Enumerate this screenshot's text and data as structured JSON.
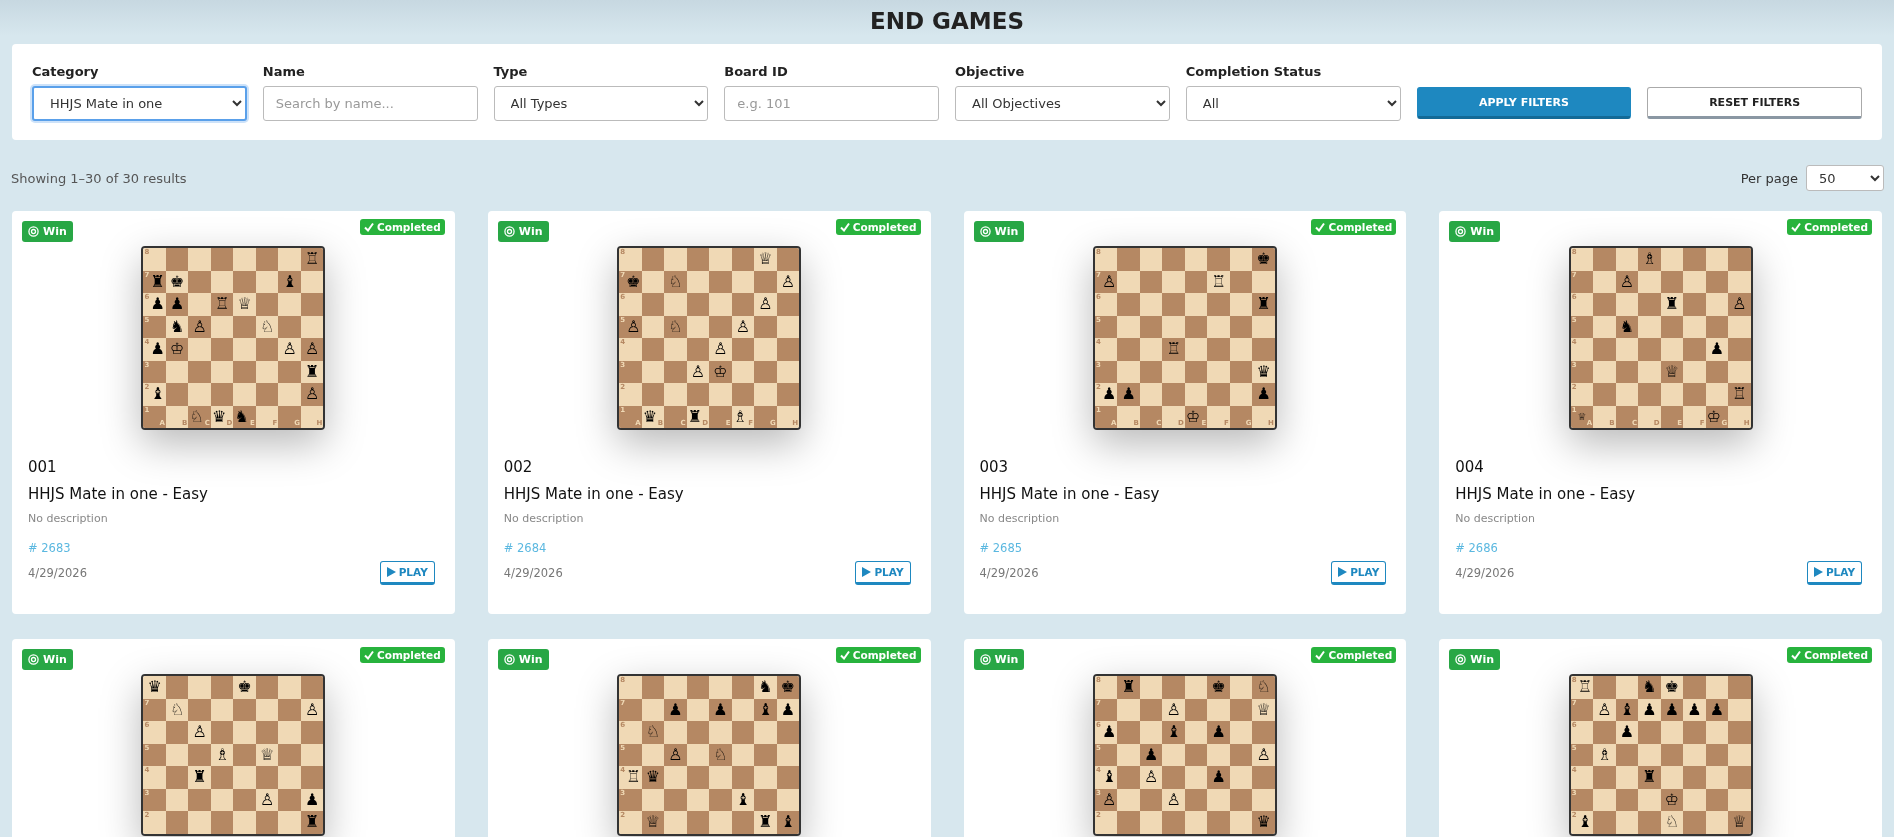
{
  "page_title": "END GAMES",
  "filters": [
    {
      "kind": "select",
      "label": "Category",
      "value": "HHJS Mate in one",
      "focused": true
    },
    {
      "kind": "text",
      "label": "Name",
      "placeholder": "Search by name...",
      "focused": false
    },
    {
      "kind": "select",
      "label": "Type",
      "value": "All Types",
      "focused": false
    },
    {
      "kind": "text",
      "label": "Board ID",
      "placeholder": "e.g. 101",
      "focused": false
    },
    {
      "kind": "select",
      "label": "Objective",
      "value": "All Objectives",
      "focused": false
    },
    {
      "kind": "select",
      "label": "Completion Status",
      "value": "All",
      "focused": false
    }
  ],
  "buttons": [
    {
      "label": "APPLY FILTERS",
      "kind": "primary"
    },
    {
      "label": "RESET FILTERS",
      "kind": "secondary"
    }
  ],
  "results_summary": "Showing 1–30 of 30 results",
  "per_page": {
    "label": "Per page",
    "value": "50"
  },
  "cards": [
    {
      "objective": "Win",
      "status": "Completed",
      "board": {
        "rank_labels": [
          "8",
          "7",
          "6",
          "5",
          "4",
          "3",
          "2",
          "1"
        ],
        "file_labels": [
          "A",
          "B",
          "C",
          "D",
          "E",
          "F",
          "G",
          "H"
        ],
        "ranks": [
          [
            {
              "kind": "light"
            },
            {
              "kind": "dark"
            },
            {
              "kind": "light"
            },
            {
              "kind": "dark"
            },
            {
              "kind": "light"
            },
            {
              "kind": "dark"
            },
            {
              "kind": "light"
            },
            {
              "kind": "dark",
              "piece": "♖"
            }
          ],
          [
            {
              "kind": "dark",
              "piece": "♜"
            },
            {
              "kind": "light",
              "piece": "♚"
            },
            {
              "kind": "dark"
            },
            {
              "kind": "light"
            },
            {
              "kind": "dark"
            },
            {
              "kind": "light"
            },
            {
              "kind": "dark",
              "piece": "♝"
            },
            {
              "kind": "light"
            }
          ],
          [
            {
              "kind": "light",
              "piece": "♟"
            },
            {
              "kind": "dark",
              "piece": "♟"
            },
            {
              "kind": "light"
            },
            {
              "kind": "dark",
              "piece": "♖"
            },
            {
              "kind": "light",
              "piece": "♕"
            },
            {
              "kind": "dark"
            },
            {
              "kind": "light"
            },
            {
              "kind": "dark"
            }
          ],
          [
            {
              "kind": "dark"
            },
            {
              "kind": "light",
              "piece": "♞"
            },
            {
              "kind": "dark",
              "piece": "♙"
            },
            {
              "kind": "light"
            },
            {
              "kind": "dark"
            },
            {
              "kind": "light",
              "piece": "♘"
            },
            {
              "kind": "dark"
            },
            {
              "kind": "light"
            }
          ],
          [
            {
              "kind": "light",
              "piece": "♟"
            },
            {
              "kind": "dark",
              "piece": "♔"
            },
            {
              "kind": "light"
            },
            {
              "kind": "dark"
            },
            {
              "kind": "light"
            },
            {
              "kind": "dark"
            },
            {
              "kind": "light",
              "piece": "♙"
            },
            {
              "kind": "dark",
              "piece": "♙"
            }
          ],
          [
            {
              "kind": "dark"
            },
            {
              "kind": "light"
            },
            {
              "kind": "dark"
            },
            {
              "kind": "light"
            },
            {
              "kind": "dark"
            },
            {
              "kind": "light"
            },
            {
              "kind": "dark"
            },
            {
              "kind": "light",
              "piece": "♜"
            }
          ],
          [
            {
              "kind": "light",
              "piece": "♝"
            },
            {
              "kind": "dark"
            },
            {
              "kind": "light"
            },
            {
              "kind": "dark"
            },
            {
              "kind": "light"
            },
            {
              "kind": "dark"
            },
            {
              "kind": "light"
            },
            {
              "kind": "dark",
              "piece": "♙"
            }
          ],
          [
            {
              "kind": "dark"
            },
            {
              "kind": "light"
            },
            {
              "kind": "dark",
              "piece": "♘"
            },
            {
              "kind": "light",
              "piece": "♛"
            },
            {
              "kind": "dark",
              "piece": "♞"
            },
            {
              "kind": "light"
            },
            {
              "kind": "dark"
            },
            {
              "kind": "light"
            }
          ]
        ]
      },
      "number": "001",
      "title": "HHJS Mate in one - Easy",
      "description": "No description",
      "id": "# 2683",
      "date": "4/29/2026",
      "action": "PLAY"
    },
    {
      "objective": "Win",
      "status": "Completed",
      "board": {
        "rank_labels": [
          "8",
          "7",
          "6",
          "5",
          "4",
          "3",
          "2",
          "1"
        ],
        "file_labels": [
          "A",
          "B",
          "C",
          "D",
          "E",
          "F",
          "G",
          "H"
        ],
        "ranks": [
          [
            {
              "kind": "light"
            },
            {
              "kind": "dark"
            },
            {
              "kind": "light"
            },
            {
              "kind": "dark"
            },
            {
              "kind": "light"
            },
            {
              "kind": "dark"
            },
            {
              "kind": "light",
              "piece": "♕"
            },
            {
              "kind": "dark"
            }
          ],
          [
            {
              "kind": "dark",
              "piece": "♚"
            },
            {
              "kind": "light"
            },
            {
              "kind": "dark",
              "piece": "♘"
            },
            {
              "kind": "light"
            },
            {
              "kind": "dark"
            },
            {
              "kind": "light"
            },
            {
              "kind": "dark"
            },
            {
              "kind": "light",
              "piece": "♙"
            }
          ],
          [
            {
              "kind": "light"
            },
            {
              "kind": "dark"
            },
            {
              "kind": "light"
            },
            {
              "kind": "dark"
            },
            {
              "kind": "light"
            },
            {
              "kind": "dark"
            },
            {
              "kind": "light",
              "piece": "♙"
            },
            {
              "kind": "dark"
            }
          ],
          [
            {
              "kind": "dark",
              "piece": "♙"
            },
            {
              "kind": "light"
            },
            {
              "kind": "dark",
              "piece": "♘"
            },
            {
              "kind": "light"
            },
            {
              "kind": "dark"
            },
            {
              "kind": "light",
              "piece": "♙"
            },
            {
              "kind": "dark"
            },
            {
              "kind": "light"
            }
          ],
          [
            {
              "kind": "light"
            },
            {
              "kind": "dark"
            },
            {
              "kind": "light"
            },
            {
              "kind": "dark"
            },
            {
              "kind": "light",
              "piece": "♙"
            },
            {
              "kind": "dark"
            },
            {
              "kind": "light"
            },
            {
              "kind": "dark"
            }
          ],
          [
            {
              "kind": "dark"
            },
            {
              "kind": "light"
            },
            {
              "kind": "dark"
            },
            {
              "kind": "light",
              "piece": "♙"
            },
            {
              "kind": "dark",
              "piece": "♔"
            },
            {
              "kind": "light"
            },
            {
              "kind": "dark"
            },
            {
              "kind": "light"
            }
          ],
          [
            {
              "kind": "light"
            },
            {
              "kind": "dark"
            },
            {
              "kind": "light"
            },
            {
              "kind": "dark"
            },
            {
              "kind": "light"
            },
            {
              "kind": "dark"
            },
            {
              "kind": "light"
            },
            {
              "kind": "dark"
            }
          ],
          [
            {
              "kind": "dark"
            },
            {
              "kind": "light",
              "piece": "♛"
            },
            {
              "kind": "dark"
            },
            {
              "kind": "light",
              "piece": "♜"
            },
            {
              "kind": "dark"
            },
            {
              "kind": "light",
              "piece": "♗"
            },
            {
              "kind": "dark"
            },
            {
              "kind": "light"
            }
          ]
        ]
      },
      "number": "002",
      "title": "HHJS Mate in one - Easy",
      "description": "No description",
      "id": "# 2684",
      "date": "4/29/2026",
      "action": "PLAY"
    },
    {
      "objective": "Win",
      "status": "Completed",
      "board": {
        "rank_labels": [
          "8",
          "7",
          "6",
          "5",
          "4",
          "3",
          "2",
          "1"
        ],
        "file_labels": [
          "A",
          "B",
          "C",
          "D",
          "E",
          "F",
          "G",
          "H"
        ],
        "ranks": [
          [
            {
              "kind": "light"
            },
            {
              "kind": "dark"
            },
            {
              "kind": "light"
            },
            {
              "kind": "dark"
            },
            {
              "kind": "light"
            },
            {
              "kind": "dark"
            },
            {
              "kind": "light"
            },
            {
              "kind": "dark",
              "piece": "♚"
            }
          ],
          [
            {
              "kind": "dark",
              "piece": "♙"
            },
            {
              "kind": "light"
            },
            {
              "kind": "dark"
            },
            {
              "kind": "light"
            },
            {
              "kind": "dark"
            },
            {
              "kind": "light",
              "piece": "♖"
            },
            {
              "kind": "dark"
            },
            {
              "kind": "light"
            }
          ],
          [
            {
              "kind": "light"
            },
            {
              "kind": "dark"
            },
            {
              "kind": "light"
            },
            {
              "kind": "dark"
            },
            {
              "kind": "light"
            },
            {
              "kind": "dark"
            },
            {
              "kind": "light"
            },
            {
              "kind": "dark",
              "piece": "♜"
            }
          ],
          [
            {
              "kind": "dark"
            },
            {
              "kind": "light"
            },
            {
              "kind": "dark"
            },
            {
              "kind": "light"
            },
            {
              "kind": "dark"
            },
            {
              "kind": "light"
            },
            {
              "kind": "dark"
            },
            {
              "kind": "light"
            }
          ],
          [
            {
              "kind": "light"
            },
            {
              "kind": "dark"
            },
            {
              "kind": "light"
            },
            {
              "kind": "dark",
              "piece": "♖"
            },
            {
              "kind": "light"
            },
            {
              "kind": "dark"
            },
            {
              "kind": "light"
            },
            {
              "kind": "dark"
            }
          ],
          [
            {
              "kind": "dark"
            },
            {
              "kind": "light"
            },
            {
              "kind": "dark"
            },
            {
              "kind": "light"
            },
            {
              "kind": "dark"
            },
            {
              "kind": "light"
            },
            {
              "kind": "dark"
            },
            {
              "kind": "light",
              "piece": "♛"
            }
          ],
          [
            {
              "kind": "light",
              "piece": "♟"
            },
            {
              "kind": "dark",
              "piece": "♟"
            },
            {
              "kind": "light"
            },
            {
              "kind": "dark"
            },
            {
              "kind": "light"
            },
            {
              "kind": "dark"
            },
            {
              "kind": "light"
            },
            {
              "kind": "dark",
              "piece": "♟"
            }
          ],
          [
            {
              "kind": "dark"
            },
            {
              "kind": "light"
            },
            {
              "kind": "dark"
            },
            {
              "kind": "light"
            },
            {
              "kind": "dark",
              "piece": "♔"
            },
            {
              "kind": "light"
            },
            {
              "kind": "dark"
            },
            {
              "kind": "light"
            }
          ]
        ]
      },
      "number": "003",
      "title": "HHJS Mate in one - Easy",
      "description": "No description",
      "id": "# 2685",
      "date": "4/29/2026",
      "action": "PLAY"
    },
    {
      "objective": "Win",
      "status": "Completed",
      "board": {
        "rank_labels": [
          "8",
          "7",
          "6",
          "5",
          "4",
          "3",
          "2",
          "1"
        ],
        "file_labels": [
          "A",
          "B",
          "C",
          "D",
          "E",
          "F",
          "G",
          "H"
        ],
        "ranks": [
          [
            {
              "kind": "light"
            },
            {
              "kind": "dark"
            },
            {
              "kind": "light"
            },
            {
              "kind": "dark",
              "piece": "♗"
            },
            {
              "kind": "light"
            },
            {
              "kind": "dark"
            },
            {
              "kind": "light"
            },
            {
              "kind": "dark"
            }
          ],
          [
            {
              "kind": "dark"
            },
            {
              "kind": "light"
            },
            {
              "kind": "dark",
              "piece": "♙"
            },
            {
              "kind": "light"
            },
            {
              "kind": "dark"
            },
            {
              "kind": "light"
            },
            {
              "kind": "dark"
            },
            {
              "kind": "light"
            }
          ],
          [
            {
              "kind": "light"
            },
            {
              "kind": "dark"
            },
            {
              "kind": "light"
            },
            {
              "kind": "dark"
            },
            {
              "kind": "light",
              "piece": "♜"
            },
            {
              "kind": "dark"
            },
            {
              "kind": "light"
            },
            {
              "kind": "dark",
              "piece": "♙"
            }
          ],
          [
            {
              "kind": "dark"
            },
            {
              "kind": "light"
            },
            {
              "kind": "dark",
              "piece": "♞"
            },
            {
              "kind": "light"
            },
            {
              "kind": "dark"
            },
            {
              "kind": "light"
            },
            {
              "kind": "dark"
            },
            {
              "kind": "light"
            }
          ],
          [
            {
              "kind": "light"
            },
            {
              "kind": "dark"
            },
            {
              "kind": "light"
            },
            {
              "kind": "dark"
            },
            {
              "kind": "light"
            },
            {
              "kind": "dark"
            },
            {
              "kind": "light",
              "piece": "♟"
            },
            {
              "kind": "dark"
            }
          ],
          [
            {
              "kind": "dark"
            },
            {
              "kind": "light"
            },
            {
              "kind": "dark"
            },
            {
              "kind": "light"
            },
            {
              "kind": "dark",
              "piece": "♕"
            },
            {
              "kind": "light"
            },
            {
              "kind": "dark"
            },
            {
              "kind": "light"
            }
          ],
          [
            {
              "kind": "light"
            },
            {
              "kind": "dark"
            },
            {
              "kind": "light"
            },
            {
              "kind": "dark"
            },
            {
              "kind": "light"
            },
            {
              "kind": "dark"
            },
            {
              "kind": "light"
            },
            {
              "kind": "dark",
              "piece": "♖"
            }
          ],
          [
            {
              "kind": "dark",
              "piece": "♕"
            },
            {
              "kind": "light"
            },
            {
              "kind": "dark"
            },
            {
              "kind": "light"
            },
            {
              "kind": "dark"
            },
            {
              "kind": "light"
            },
            {
              "kind": "dark",
              "piece": "♔"
            },
            {
              "kind": "light"
            }
          ]
        ]
      },
      "number": "004",
      "title": "HHJS Mate in one - Easy",
      "description": "No description",
      "id": "# 2686",
      "date": "4/29/2026",
      "action": "PLAY"
    },
    {
      "objective": "Win",
      "status": "Completed",
      "board": {
        "rank_labels": [
          "7",
          "6",
          "5",
          "4",
          "3",
          "2"
        ],
        "ranks": [
          [
            {
              "kind": "light",
              "piece": "♛"
            },
            {
              "kind": "dark"
            },
            {
              "kind": "light"
            },
            {
              "kind": "dark"
            },
            {
              "kind": "light",
              "piece": "♚"
            },
            {
              "kind": "dark"
            },
            {
              "kind": "light"
            },
            {
              "kind": "dark"
            }
          ],
          [
            {
              "kind": "dark"
            },
            {
              "kind": "light",
              "piece": "♘"
            },
            {
              "kind": "dark"
            },
            {
              "kind": "light"
            },
            {
              "kind": "dark"
            },
            {
              "kind": "light"
            },
            {
              "kind": "dark"
            },
            {
              "kind": "light",
              "piece": "♙"
            }
          ],
          [
            {
              "kind": "light"
            },
            {
              "kind": "dark"
            },
            {
              "kind": "light",
              "piece": "♙"
            },
            {
              "kind": "dark"
            },
            {
              "kind": "light"
            },
            {
              "kind": "dark"
            },
            {
              "kind": "light"
            },
            {
              "kind": "dark"
            }
          ],
          [
            {
              "kind": "dark"
            },
            {
              "kind": "light"
            },
            {
              "kind": "dark"
            },
            {
              "kind": "light",
              "piece": "♗"
            },
            {
              "kind": "dark"
            },
            {
              "kind": "light",
              "piece": "♕"
            },
            {
              "kind": "dark"
            },
            {
              "kind": "light"
            }
          ],
          [
            {
              "kind": "light"
            },
            {
              "kind": "dark"
            },
            {
              "kind": "light",
              "piece": "♜"
            },
            {
              "kind": "dark"
            },
            {
              "kind": "light"
            },
            {
              "kind": "dark"
            },
            {
              "kind": "light"
            },
            {
              "kind": "dark"
            }
          ],
          [
            {
              "kind": "dark"
            },
            {
              "kind": "light"
            },
            {
              "kind": "dark"
            },
            {
              "kind": "light"
            },
            {
              "kind": "dark"
            },
            {
              "kind": "light",
              "piece": "♙"
            },
            {
              "kind": "dark"
            },
            {
              "kind": "light",
              "piece": "♟"
            }
          ],
          [
            {
              "kind": "light"
            },
            {
              "kind": "dark"
            },
            {
              "kind": "light"
            },
            {
              "kind": "dark"
            },
            {
              "kind": "light"
            },
            {
              "kind": "dark"
            },
            {
              "kind": "light"
            },
            {
              "kind": "dark",
              "piece": "♜"
            }
          ]
        ]
      }
    },
    {
      "objective": "Win",
      "status": "Completed",
      "board": {
        "rank_labels": [
          "8",
          "7",
          "6",
          "5",
          "4",
          "3",
          "2"
        ],
        "ranks": [
          [
            {
              "kind": "light"
            },
            {
              "kind": "dark"
            },
            {
              "kind": "light"
            },
            {
              "kind": "dark"
            },
            {
              "kind": "light"
            },
            {
              "kind": "dark"
            },
            {
              "kind": "light",
              "piece": "♞"
            },
            {
              "kind": "dark",
              "piece": "♚"
            }
          ],
          [
            {
              "kind": "dark"
            },
            {
              "kind": "light"
            },
            {
              "kind": "dark",
              "piece": "♟"
            },
            {
              "kind": "light"
            },
            {
              "kind": "dark",
              "piece": "♟"
            },
            {
              "kind": "light"
            },
            {
              "kind": "dark",
              "piece": "♝"
            },
            {
              "kind": "light",
              "piece": "♟"
            }
          ],
          [
            {
              "kind": "light"
            },
            {
              "kind": "dark",
              "piece": "♘"
            },
            {
              "kind": "light"
            },
            {
              "kind": "dark"
            },
            {
              "kind": "light"
            },
            {
              "kind": "dark"
            },
            {
              "kind": "light"
            },
            {
              "kind": "dark"
            }
          ],
          [
            {
              "kind": "dark"
            },
            {
              "kind": "light"
            },
            {
              "kind": "dark",
              "piece": "♙"
            },
            {
              "kind": "light"
            },
            {
              "kind": "dark",
              "piece": "♘"
            },
            {
              "kind": "light"
            },
            {
              "kind": "dark"
            },
            {
              "kind": "light"
            }
          ],
          [
            {
              "kind": "light",
              "piece": "♖"
            },
            {
              "kind": "dark",
              "piece": "♛"
            },
            {
              "kind": "light"
            },
            {
              "kind": "dark"
            },
            {
              "kind": "light"
            },
            {
              "kind": "dark"
            },
            {
              "kind": "light"
            },
            {
              "kind": "dark"
            }
          ],
          [
            {
              "kind": "dark"
            },
            {
              "kind": "light"
            },
            {
              "kind": "dark"
            },
            {
              "kind": "light"
            },
            {
              "kind": "dark"
            },
            {
              "kind": "light",
              "piece": "♝"
            },
            {
              "kind": "dark"
            },
            {
              "kind": "light"
            }
          ],
          [
            {
              "kind": "light"
            },
            {
              "kind": "dark",
              "piece": "♕"
            },
            {
              "kind": "light"
            },
            {
              "kind": "dark"
            },
            {
              "kind": "light"
            },
            {
              "kind": "dark"
            },
            {
              "kind": "light",
              "piece": "♜"
            },
            {
              "kind": "dark",
              "piece": "♝"
            }
          ]
        ]
      }
    },
    {
      "objective": "Win",
      "status": "Completed",
      "board": {
        "rank_labels": [
          "8",
          "7",
          "6",
          "5",
          "4",
          "3",
          "2"
        ],
        "ranks": [
          [
            {
              "kind": "light"
            },
            {
              "kind": "dark",
              "piece": "♜"
            },
            {
              "kind": "light"
            },
            {
              "kind": "dark"
            },
            {
              "kind": "light"
            },
            {
              "kind": "dark",
              "piece": "♚"
            },
            {
              "kind": "light"
            },
            {
              "kind": "dark",
              "piece": "♘"
            }
          ],
          [
            {
              "kind": "dark"
            },
            {
              "kind": "light"
            },
            {
              "kind": "dark"
            },
            {
              "kind": "light",
              "piece": "♙"
            },
            {
              "kind": "dark"
            },
            {
              "kind": "light"
            },
            {
              "kind": "dark"
            },
            {
              "kind": "light",
              "piece": "♕"
            }
          ],
          [
            {
              "kind": "light",
              "piece": "♟"
            },
            {
              "kind": "dark"
            },
            {
              "kind": "light"
            },
            {
              "kind": "dark",
              "piece": "♝"
            },
            {
              "kind": "light"
            },
            {
              "kind": "dark",
              "piece": "♟"
            },
            {
              "kind": "light"
            },
            {
              "kind": "dark"
            }
          ],
          [
            {
              "kind": "dark"
            },
            {
              "kind": "light"
            },
            {
              "kind": "dark",
              "piece": "♟"
            },
            {
              "kind": "light"
            },
            {
              "kind": "dark"
            },
            {
              "kind": "light"
            },
            {
              "kind": "dark"
            },
            {
              "kind": "light",
              "piece": "♙"
            }
          ],
          [
            {
              "kind": "light",
              "piece": "♝"
            },
            {
              "kind": "dark"
            },
            {
              "kind": "light",
              "piece": "♙"
            },
            {
              "kind": "dark"
            },
            {
              "kind": "light"
            },
            {
              "kind": "dark",
              "piece": "♟"
            },
            {
              "kind": "light"
            },
            {
              "kind": "dark"
            }
          ],
          [
            {
              "kind": "dark",
              "piece": "♙"
            },
            {
              "kind": "light"
            },
            {
              "kind": "dark"
            },
            {
              "kind": "light",
              "piece": "♙"
            },
            {
              "kind": "dark"
            },
            {
              "kind": "light"
            },
            {
              "kind": "dark"
            },
            {
              "kind": "light"
            }
          ],
          [
            {
              "kind": "light"
            },
            {
              "kind": "dark"
            },
            {
              "kind": "light"
            },
            {
              "kind": "dark"
            },
            {
              "kind": "light"
            },
            {
              "kind": "dark"
            },
            {
              "kind": "light"
            },
            {
              "kind": "dark",
              "piece": "♛"
            }
          ]
        ]
      }
    },
    {
      "objective": "Win",
      "status": "Completed",
      "board": {
        "rank_labels": [
          "8",
          "7",
          "6",
          "5",
          "4",
          "3",
          "2"
        ],
        "ranks": [
          [
            {
              "kind": "light",
              "piece": "♖"
            },
            {
              "kind": "dark"
            },
            {
              "kind": "light"
            },
            {
              "kind": "dark",
              "piece": "♞"
            },
            {
              "kind": "light",
              "piece": "♚"
            },
            {
              "kind": "dark"
            },
            {
              "kind": "light"
            },
            {
              "kind": "dark"
            }
          ],
          [
            {
              "kind": "dark"
            },
            {
              "kind": "light",
              "piece": "♙"
            },
            {
              "kind": "dark",
              "piece": "♝"
            },
            {
              "kind": "light",
              "piece": "♟"
            },
            {
              "kind": "dark",
              "piece": "♟"
            },
            {
              "kind": "light",
              "piece": "♟"
            },
            {
              "kind": "dark",
              "piece": "♟"
            },
            {
              "kind": "light"
            }
          ],
          [
            {
              "kind": "light"
            },
            {
              "kind": "dark"
            },
            {
              "kind": "light",
              "piece": "♟"
            },
            {
              "kind": "dark"
            },
            {
              "kind": "light"
            },
            {
              "kind": "dark"
            },
            {
              "kind": "light"
            },
            {
              "kind": "dark"
            }
          ],
          [
            {
              "kind": "dark"
            },
            {
              "kind": "light",
              "piece": "♗"
            },
            {
              "kind": "dark"
            },
            {
              "kind": "light"
            },
            {
              "kind": "dark"
            },
            {
              "kind": "light"
            },
            {
              "kind": "dark"
            },
            {
              "kind": "light"
            }
          ],
          [
            {
              "kind": "light"
            },
            {
              "kind": "dark"
            },
            {
              "kind": "light"
            },
            {
              "kind": "dark",
              "piece": "♜"
            },
            {
              "kind": "light"
            },
            {
              "kind": "dark"
            },
            {
              "kind": "light"
            },
            {
              "kind": "dark"
            }
          ],
          [
            {
              "kind": "dark"
            },
            {
              "kind": "light"
            },
            {
              "kind": "dark"
            },
            {
              "kind": "light"
            },
            {
              "kind": "dark",
              "piece": "♔"
            },
            {
              "kind": "light"
            },
            {
              "kind": "dark"
            },
            {
              "kind": "light"
            }
          ],
          [
            {
              "kind": "light",
              "piece": "♝"
            },
            {
              "kind": "dark"
            },
            {
              "kind": "light"
            },
            {
              "kind": "dark"
            },
            {
              "kind": "light",
              "piece": "♘"
            },
            {
              "kind": "dark"
            },
            {
              "kind": "light"
            },
            {
              "kind": "dark",
              "piece": "♕"
            }
          ]
        ]
      }
    }
  ]
}
